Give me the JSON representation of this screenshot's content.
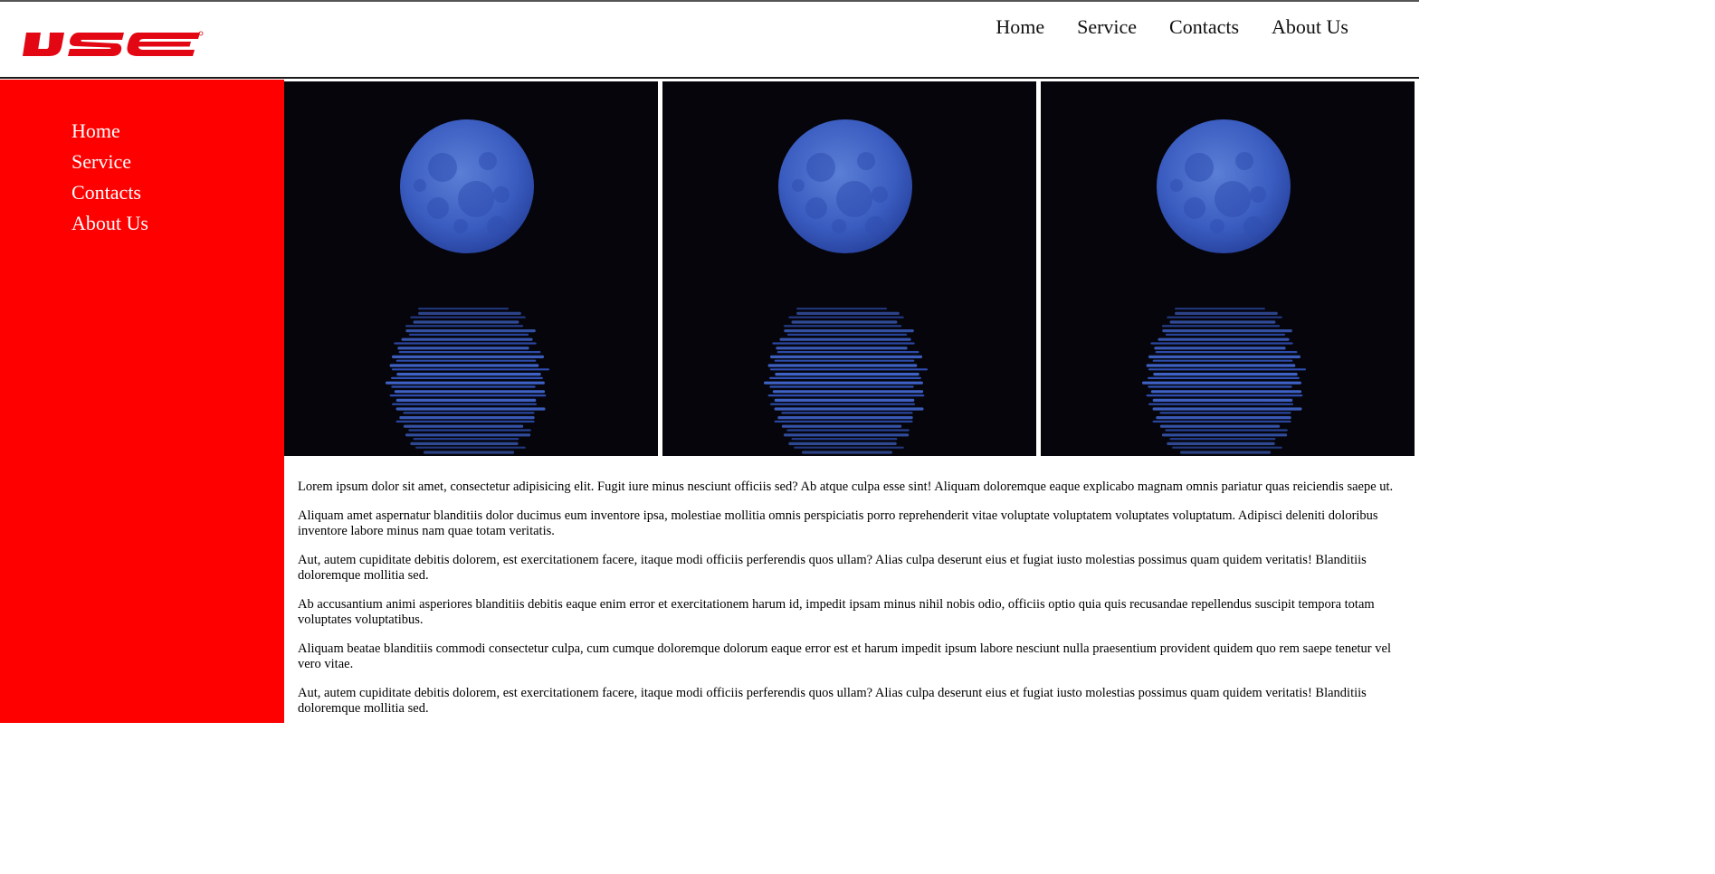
{
  "header": {
    "logo_text": "IJSE",
    "logo_color": "#e30613",
    "nav": [
      "Home",
      "Service",
      "Contacts",
      "About Us"
    ]
  },
  "sidebar": {
    "background": "#ff0000",
    "nav": [
      "Home",
      "Service",
      "Contacts",
      "About Us"
    ]
  },
  "gallery": {
    "images": [
      {
        "icon": "moon-reflection-image"
      },
      {
        "icon": "moon-reflection-image"
      },
      {
        "icon": "moon-reflection-image"
      }
    ]
  },
  "content": {
    "paragraphs": [
      "Lorem ipsum dolor sit amet, consectetur adipisicing elit. Fugit iure minus nesciunt officiis sed? Ab atque culpa esse sint! Aliquam doloremque eaque explicabo magnam omnis pariatur quas reiciendis saepe ut.",
      "Aliquam amet aspernatur blanditiis dolor ducimus eum inventore ipsa, molestiae mollitia omnis perspiciatis porro reprehenderit vitae voluptate voluptatem voluptates voluptatum. Adipisci deleniti doloribus inventore labore minus nam quae totam veritatis.",
      "Aut, autem cupiditate debitis dolorem, est exercitationem facere, itaque modi officiis perferendis quos ullam? Alias culpa deserunt eius et fugiat iusto molestias possimus quam quidem veritatis! Blanditiis doloremque mollitia sed.",
      "Ab accusantium animi asperiores blanditiis debitis eaque enim error et exercitationem harum id, impedit ipsam minus nihil nobis odio, officiis optio quia quis recusandae repellendus suscipit tempora totam voluptates voluptatibus.",
      "Aliquam beatae blanditiis commodi consectetur culpa, cum cumque doloremque dolorum eaque error est et harum impedit ipsum labore nesciunt nulla praesentium provident quidem quo rem saepe tenetur vel vero vitae.",
      "Aut, autem cupiditate debitis dolorem, est exercitationem facere, itaque modi officiis perferendis quos ullam? Alias culpa deserunt eius et fugiat iusto molestias possimus quam quidem veritatis! Blanditiis doloremque mollitia sed."
    ]
  }
}
